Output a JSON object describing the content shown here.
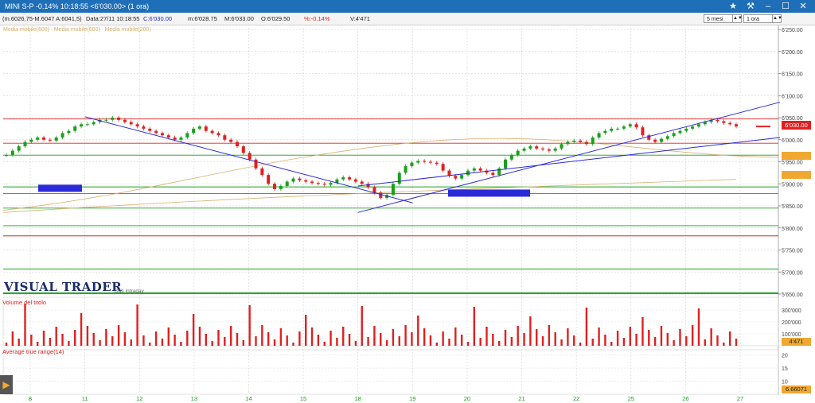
{
  "window": {
    "title": "MINI S-P -0.14% 10:18:55 <6'030.00> (1 ora)",
    "icons": [
      "star-icon",
      "tools-icon",
      "minimize-icon",
      "maximize-icon",
      "close-icon"
    ]
  },
  "infobar": {
    "quote": "(m.6026,75-M.6047 A:6041,5)",
    "date": "Data:27/11 10:18:55",
    "close": "C:6'030.00",
    "min": "m:6'028.75",
    "max": "M:6'033.00",
    "open": "O:6'029.50",
    "pct": "%:-0.14%",
    "volume": "V:4'471",
    "period_select": "5 mesi",
    "interval_select": "1 ora"
  },
  "legend": {
    "ma1": "Media mobile(600)",
    "ma2": "Media mobile(600)",
    "ma3": "Media mobile(200)"
  },
  "logo": {
    "name": "VISUAL TRADER",
    "sub": "Dati Intraday"
  },
  "panels": {
    "volume_label": "Volume del titolo",
    "atr_label": "Average true range(14)"
  },
  "tags": {
    "price": "6'030.00",
    "volume": "4'471",
    "atr": "6.66071"
  },
  "colors": {
    "up": "#1aa01a",
    "down": "#e02020",
    "trend": "#2a2ad8",
    "ma": "#d8b070",
    "titlebar": "#1f6fb8"
  },
  "chart_data": [
    {
      "type": "line",
      "name": "price",
      "y_axis_ticks": [
        "6'250.00",
        "6'200.00",
        "6'150.00",
        "6'100.00",
        "6'050.00",
        "6'000.00",
        "5'950.00",
        "5'900.00",
        "5'850.00",
        "5'800.00",
        "5'750.00",
        "5'700.00",
        "5'650.00"
      ],
      "ylim": [
        5650,
        6250
      ],
      "x_ticks": [
        "8",
        "11",
        "12",
        "13",
        "14",
        "15",
        "18",
        "19",
        "20",
        "21",
        "22",
        "25",
        "26",
        "27"
      ],
      "close_series": [
        5965,
        5975,
        5985,
        5995,
        6000,
        6005,
        6000,
        5998,
        6005,
        6015,
        6020,
        6030,
        6035,
        6035,
        6040,
        6045,
        6045,
        6050,
        6045,
        6040,
        6035,
        6030,
        6025,
        6020,
        6015,
        6010,
        6005,
        6000,
        6005,
        6015,
        6025,
        6030,
        6020,
        6015,
        6010,
        6000,
        5995,
        5985,
        5970,
        5955,
        5935,
        5920,
        5900,
        5888,
        5895,
        5905,
        5912,
        5908,
        5905,
        5902,
        5900,
        5898,
        5902,
        5910,
        5915,
        5910,
        5905,
        5900,
        5892,
        5880,
        5868,
        5875,
        5900,
        5925,
        5940,
        5948,
        5952,
        5950,
        5948,
        5945,
        5930,
        5918,
        5912,
        5920,
        5930,
        5935,
        5930,
        5925,
        5920,
        5935,
        5955,
        5965,
        5975,
        5980,
        5985,
        5980,
        5978,
        5975,
        5980,
        5990,
        5995,
        5998,
        5995,
        5990,
        6005,
        6015,
        6020,
        6025,
        6025,
        6030,
        6035,
        6028,
        6010,
        6000,
        5995,
        6002,
        6008,
        6015,
        6020,
        6025,
        6030,
        6035,
        6040,
        6045,
        6042,
        6038,
        6035,
        6030
      ],
      "horizontal_levels": [
        6047,
        5992,
        5965,
        5893,
        5878,
        5845,
        5805,
        5782,
        5707,
        5652
      ],
      "trendlines": [
        {
          "from": [
            6052,
            "11"
          ],
          "to": [
            5857,
            "19"
          ]
        },
        {
          "from": [
            5835,
            "18"
          ],
          "to": [
            6085,
            "27"
          ]
        },
        {
          "from": [
            5895,
            "18"
          ],
          "to": [
            6005,
            "27"
          ]
        }
      ]
    },
    {
      "type": "bar",
      "name": "volume",
      "y_axis_ticks": [
        "300'000",
        "200'000",
        "100'000"
      ],
      "ylim": [
        0,
        380000
      ]
    },
    {
      "type": "line",
      "name": "atr",
      "y_axis_ticks": [
        "20",
        "15",
        "10"
      ],
      "ylim": [
        5,
        22
      ]
    }
  ]
}
